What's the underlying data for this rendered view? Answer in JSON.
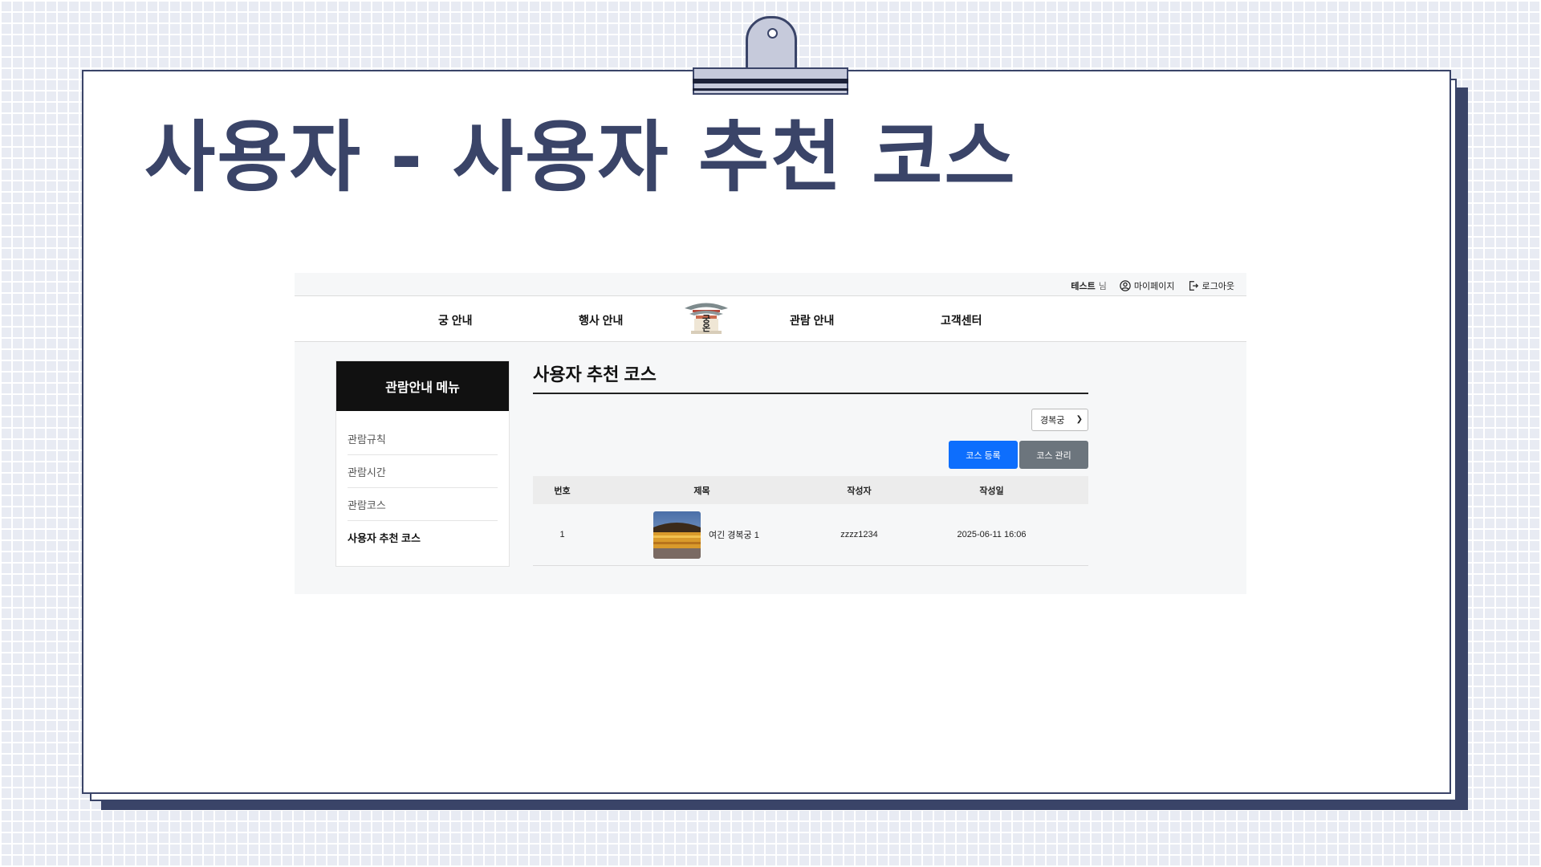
{
  "slide": {
    "title": "사용자 - 사용자 추천 코스"
  },
  "site": {
    "topbar": {
      "user_name": "테스트",
      "user_suffix": "님",
      "mypage_label": "마이페이지",
      "logout_label": "로그아웃"
    },
    "nav": {
      "items": [
        "궁 안내",
        "행사 안내",
        "관람 안내",
        "고객센터"
      ],
      "logo_text": "궁\n온"
    },
    "sidebar": {
      "heading": "관람안내 메뉴",
      "items": [
        "관람규칙",
        "관람시간",
        "관람코스",
        "사용자 추천 코스"
      ],
      "active_index": 3
    },
    "content": {
      "title": "사용자 추천 코스",
      "palace_select": {
        "selected": "경복궁"
      },
      "buttons": {
        "register": "코스 등록",
        "manage": "코스 관리"
      },
      "table": {
        "headers": [
          "번호",
          "제목",
          "작성자",
          "작성일"
        ],
        "rows": [
          {
            "no": "1",
            "title": "여긴 경복궁 1",
            "author": "zzzz1234",
            "date": "2025-06-11 16:06"
          }
        ]
      }
    }
  },
  "colors": {
    "frame": "#3a4468",
    "primary_button": "#0d6efd",
    "secondary_button": "#6c757d",
    "sidebar_head": "#111111"
  },
  "icons": [
    "user-circle-icon",
    "logout-icon",
    "palace-logo-icon",
    "chevron-down-icon",
    "clip-icon"
  ]
}
